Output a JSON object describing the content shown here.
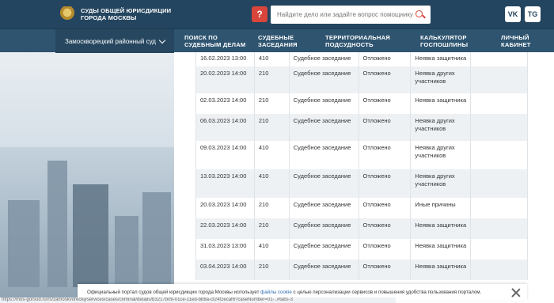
{
  "header": {
    "logo_line1": "СУДЫ ОБЩЕЙ ЮРИСДИКЦИИ",
    "logo_line2": "ГОРОДА МОСКВЫ",
    "help_glyph": "?",
    "search_placeholder": "Найдите дело или задайте вопрос помощнику",
    "social": [
      {
        "label": "VK",
        "icon": "vk-icon"
      },
      {
        "label": "TG",
        "icon": "telegram-icon"
      }
    ]
  },
  "nav": {
    "court_select": "Замоскворецкий районный суд",
    "items": [
      {
        "line1": "ПОИСК ПО",
        "line2": "СУДЕБНЫМ ДЕЛАМ"
      },
      {
        "line1": "СУДЕБНЫЕ",
        "line2": "ЗАСЕДАНИЯ"
      },
      {
        "line1": "ТЕРРИТОРИАЛЬНАЯ",
        "line2": "ПОДСУДНОСТЬ"
      },
      {
        "line1": "КАЛЬКУЛЯТОР",
        "line2": "ГОСПОШЛИНЫ"
      },
      {
        "line1": "ЛИЧНЫЙ",
        "line2": "КАБИНЕТ"
      }
    ]
  },
  "hearings": [
    {
      "datetime": "16.02.2023 13:00",
      "room": "410",
      "type": "Судебное заседание",
      "result": "Отложено",
      "reason": "Неявка защитника"
    },
    {
      "datetime": "20.02.2023 14:00",
      "room": "210",
      "type": "Судебное заседание",
      "result": "Отложено",
      "reason": "Неявка других участников"
    },
    {
      "datetime": "02.03.2023 14:00",
      "room": "210",
      "type": "Судебное заседание",
      "result": "Отложено",
      "reason": "Неявка защитника"
    },
    {
      "datetime": "06.03.2023 14:00",
      "room": "210",
      "type": "Судебное заседание",
      "result": "Отложено",
      "reason": "Неявка других участников"
    },
    {
      "datetime": "09.03.2023 14:00",
      "room": "410",
      "type": "Судебное заседание",
      "result": "Отложено",
      "reason": "Неявка других участников"
    },
    {
      "datetime": "13.03.2023 14:00",
      "room": "410",
      "type": "Судебное заседание",
      "result": "Отложено",
      "reason": "Неявка других участников"
    },
    {
      "datetime": "20.03.2023 14:00",
      "room": "210",
      "type": "Судебное заседание",
      "result": "Отложено",
      "reason": "Иные причины"
    },
    {
      "datetime": "22.03.2023 14:00",
      "room": "210",
      "type": "Судебное заседание",
      "result": "Отложено",
      "reason": "Неявка защитника"
    },
    {
      "datetime": "31.03.2023 13:00",
      "room": "410",
      "type": "Судебное заседание",
      "result": "Отложено",
      "reason": "Неявка защитника"
    },
    {
      "datetime": "03.04.2023 14:00",
      "room": "210",
      "type": "Судебное заседание",
      "result": "Отложено",
      "reason": "Неявка защитника"
    }
  ],
  "cookie": {
    "text_before": "Официальный портал судов общей юрисдикции города Москвы использует ",
    "link": "файлы cookie",
    "text_after": " с целью персонализации сервисов и повышения удобства пользования порталом."
  },
  "status_url": "https://mos-gorsud.ru/rs/zamoskvoreckij/services/cases/criminal/details/b3217b09-01ce-11ed-bb8a-cf24f2ecaf6?caseNumber=01-..#tabs-3",
  "colors": {
    "header": "#24455f",
    "nav": "#2e5470",
    "accent": "#d9453b",
    "link": "#2a6db5"
  }
}
